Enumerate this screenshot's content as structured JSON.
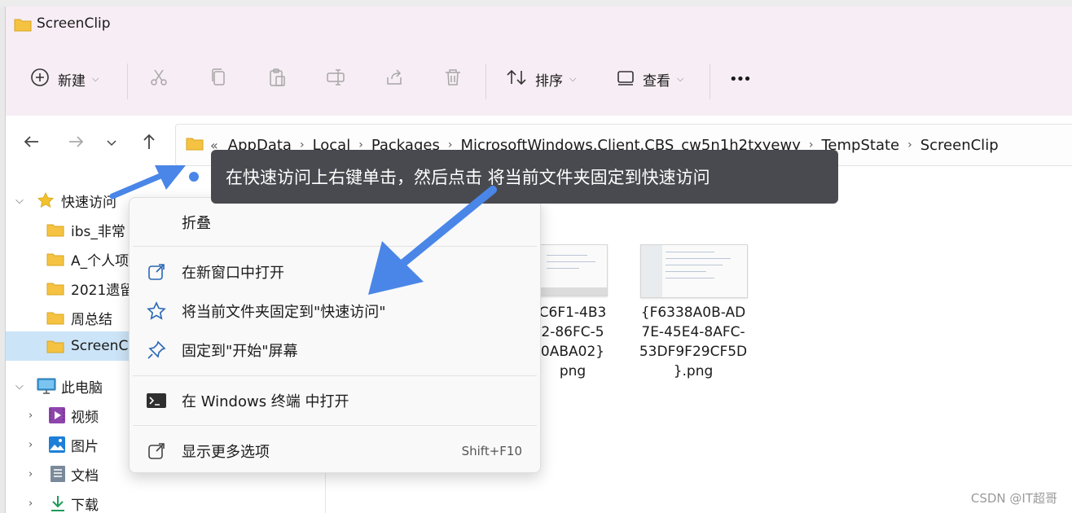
{
  "window": {
    "title": "ScreenClip"
  },
  "toolbar": {
    "new_label": "新建",
    "sort_label": "排序",
    "view_label": "查看",
    "more_label": "•••"
  },
  "address": {
    "overflow": "«",
    "crumbs": [
      "AppData",
      "Local",
      "Packages",
      "MicrosoftWindows.Client.CBS_cw5n1h2txyewy",
      "TempState",
      "ScreenClip"
    ]
  },
  "sidebar": {
    "items": [
      {
        "label": "快速访问",
        "icon": "star-icon"
      },
      {
        "label": "ibs_非常",
        "icon": "folder-icon"
      },
      {
        "label": "A_个人项",
        "icon": "folder-icon"
      },
      {
        "label": "2021遗留",
        "icon": "folder-icon"
      },
      {
        "label": "周总结",
        "icon": "folder-icon"
      },
      {
        "label": "ScreenC",
        "icon": "folder-icon"
      },
      {
        "label": "此电脑",
        "icon": "computer-icon"
      },
      {
        "label": "视频",
        "icon": "video-icon"
      },
      {
        "label": "图片",
        "icon": "picture-icon"
      },
      {
        "label": "文档",
        "icon": "document-icon"
      },
      {
        "label": "下载",
        "icon": "download-icon"
      }
    ]
  },
  "files": [
    {
      "name_lines": [
        "C6F1-4B3",
        "2-86FC-5",
        "0ABA02}",
        "png"
      ]
    },
    {
      "name_lines": [
        "{F6338A0B-AD",
        "7E-45E4-8AFC-",
        "53DF9F29CF5D",
        "}.png"
      ]
    }
  ],
  "context_menu": {
    "items": [
      {
        "label": "折叠",
        "icon": ""
      },
      {
        "label": "在新窗口中打开",
        "icon": "open-new-window-icon"
      },
      {
        "label": "将当前文件夹固定到\"快速访问\"",
        "icon": "star-outline-icon"
      },
      {
        "label": "固定到\"开始\"屏幕",
        "icon": "pin-icon"
      },
      {
        "label": "在 Windows 终端 中打开",
        "icon": "terminal-icon"
      },
      {
        "label": "显示更多选项",
        "icon": "more-options-icon",
        "shortcut": "Shift+F10"
      }
    ]
  },
  "annotation": {
    "text": "在快速访问上右键单击，然后点击 将当前文件夹固定到快速访问"
  },
  "watermark": "CSDN @IT超哥",
  "colors": {
    "accent": "#4a86e8",
    "selected": "#cce4f7",
    "folder": "#f5c242",
    "tooltip": "#494a4f"
  }
}
